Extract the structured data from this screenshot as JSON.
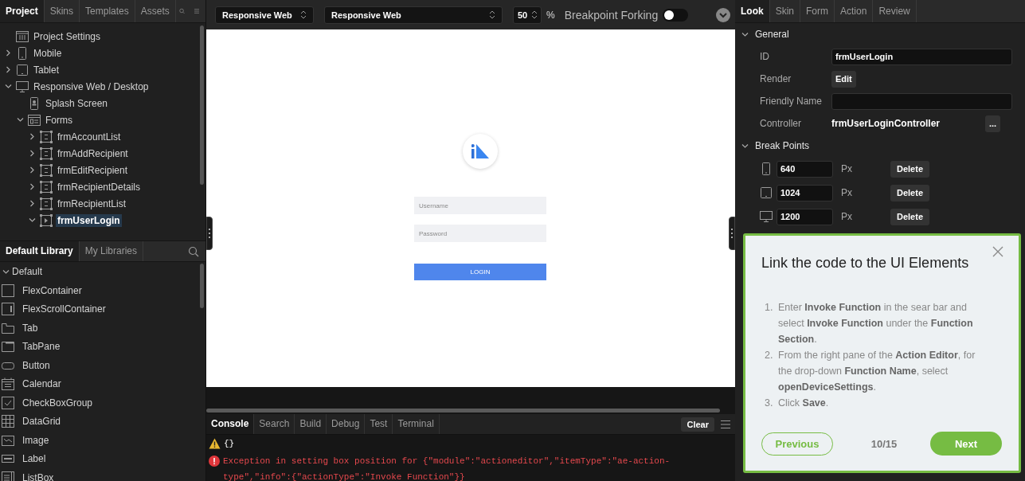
{
  "project_tabs": [
    {
      "label": "Project",
      "selected": true
    },
    {
      "label": "Skins",
      "selected": false
    },
    {
      "label": "Templates",
      "selected": false
    },
    {
      "label": "Assets",
      "selected": false
    }
  ],
  "project_tree": [
    {
      "label": "Project Settings",
      "kind": "settings",
      "selected": false
    },
    {
      "label": "Mobile",
      "kind": "mobile",
      "expanded": false,
      "selected": false
    },
    {
      "label": "Tablet",
      "kind": "tablet",
      "expanded": false,
      "selected": false
    },
    {
      "label": "Responsive Web / Desktop",
      "kind": "desktop",
      "expanded": true,
      "selected": false,
      "children": [
        {
          "label": "Splash Screen",
          "kind": "splash",
          "selected": false
        },
        {
          "label": "Forms",
          "kind": "forms",
          "expanded": true,
          "selected": false,
          "children": [
            {
              "label": "frmAccountList",
              "kind": "form",
              "expanded": false,
              "selected": false
            },
            {
              "label": "frmAddRecipient",
              "kind": "form",
              "expanded": false,
              "selected": false
            },
            {
              "label": "frmEditRecipient",
              "kind": "form",
              "expanded": false,
              "selected": false
            },
            {
              "label": "frmRecipientDetails",
              "kind": "form",
              "expanded": false,
              "selected": false
            },
            {
              "label": "frmRecipientList",
              "kind": "form",
              "expanded": false,
              "selected": false
            },
            {
              "label": "frmUserLogin",
              "kind": "formactive",
              "expanded": true,
              "selected": true
            }
          ]
        }
      ]
    }
  ],
  "library_tabs": [
    {
      "label": "Default Library",
      "selected": true
    },
    {
      "label": "My Libraries",
      "selected": false
    }
  ],
  "library_group": {
    "label": "Default",
    "expanded": true
  },
  "library_items": [
    {
      "label": "FlexContainer",
      "kind": "flex"
    },
    {
      "label": "FlexScrollContainer",
      "kind": "flexscroll"
    },
    {
      "label": "Tab",
      "kind": "tab"
    },
    {
      "label": "TabPane",
      "kind": "tabpane"
    },
    {
      "label": "Button",
      "kind": "button"
    },
    {
      "label": "Calendar",
      "kind": "calendar"
    },
    {
      "label": "CheckBoxGroup",
      "kind": "checkbox"
    },
    {
      "label": "DataGrid",
      "kind": "datagrid"
    },
    {
      "label": "Image",
      "kind": "image"
    },
    {
      "label": "Label",
      "kind": "label"
    },
    {
      "label": "ListBox",
      "kind": "listbox"
    }
  ],
  "toolbar": {
    "platform": "Responsive Web",
    "channel": "Responsive Web",
    "zoom": "50",
    "zoom_unit": "%",
    "breakpoint_forking": {
      "label": "Breakpoint Forking",
      "on": false
    }
  },
  "canvas": {
    "username_placeholder": "Username",
    "password_placeholder": "Password",
    "login_button": "LOGIN"
  },
  "console_tabs": [
    {
      "label": "Console",
      "selected": true
    },
    {
      "label": "Search",
      "selected": false
    },
    {
      "label": "Build",
      "selected": false
    },
    {
      "label": "Debug",
      "selected": false
    },
    {
      "label": "Test",
      "selected": false
    },
    {
      "label": "Terminal",
      "selected": false
    }
  ],
  "console_clear": "Clear",
  "console_log": [
    {
      "kind": "warning",
      "text": "{}"
    },
    {
      "kind": "error",
      "text": "Exception in setting box position for {\"module\":\"actioneditor\",\"itemType\":\"ae-action-type\",\"info\":{\"actionType\":\"Invoke Function\"}}"
    }
  ],
  "properties_tabs": [
    {
      "label": "Look",
      "selected": true
    },
    {
      "label": "Skin",
      "selected": false
    },
    {
      "label": "Form",
      "selected": false
    },
    {
      "label": "Action",
      "selected": false
    },
    {
      "label": "Review",
      "selected": false
    }
  ],
  "general": {
    "title": "General",
    "expanded": true,
    "id_label": "ID",
    "id_value": "frmUserLogin",
    "render_label": "Render",
    "render_button": "Edit",
    "friendly_name_label": "Friendly Name",
    "controller_label": "Controller",
    "controller_value": "frmUserLoginController",
    "controller_button": "..."
  },
  "break_points": {
    "title": "Break Points",
    "expanded": true,
    "rows": [
      {
        "kind": "mobile",
        "value": "640",
        "unit": "Px",
        "button": "Delete"
      },
      {
        "kind": "tablet",
        "value": "1024",
        "unit": "Px",
        "button": "Delete"
      },
      {
        "kind": "desktop",
        "value": "1200",
        "unit": "Px",
        "button": "Delete"
      }
    ]
  },
  "tutorial": {
    "title": "Link the code to the UI Elements",
    "steps": [
      {
        "number": "1.",
        "text": "Enter **Invoke Function** in the sear bar and select **Invoke Function** under the **Function Section**."
      },
      {
        "number": "2.",
        "text": "From the right pane of the **Action Editor**, for the drop-down **Function Name**, select **openDeviceSettings**."
      },
      {
        "number": "3.",
        "text": "Click **Save**."
      }
    ],
    "previous": "Previous",
    "counter": "10/15",
    "next": "Next"
  }
}
